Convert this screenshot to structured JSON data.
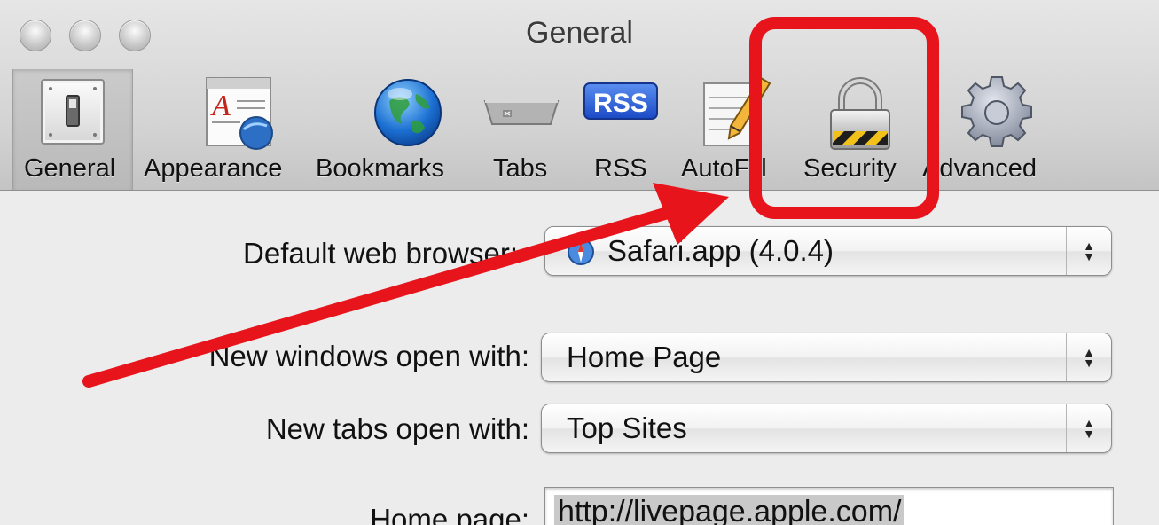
{
  "window": {
    "title": "General"
  },
  "toolbar": {
    "items": [
      {
        "label": "General",
        "icon": "general-switch-icon",
        "selected": true
      },
      {
        "label": "Appearance",
        "icon": "appearance-icon"
      },
      {
        "label": "Bookmarks",
        "icon": "globe-icon"
      },
      {
        "label": "Tabs",
        "icon": "tabs-icon"
      },
      {
        "label": "RSS",
        "icon": "rss-icon",
        "badge": "RSS"
      },
      {
        "label": "AutoFill",
        "icon": "autofill-pencil-icon"
      },
      {
        "label": "Security",
        "icon": "lock-icon"
      },
      {
        "label": "Advanced",
        "icon": "gear-icon"
      }
    ]
  },
  "general": {
    "default_browser_label": "Default web browser:",
    "default_browser_value": "Safari.app (4.0.4)",
    "new_windows_label": "New windows open with:",
    "new_windows_value": "Home Page",
    "new_tabs_label": "New tabs open with:",
    "new_tabs_value": "Top Sites",
    "home_page_label": "Home page:",
    "home_page_value": "http://livepage.apple.com/"
  },
  "annotation": {
    "color": "#e8141b"
  }
}
